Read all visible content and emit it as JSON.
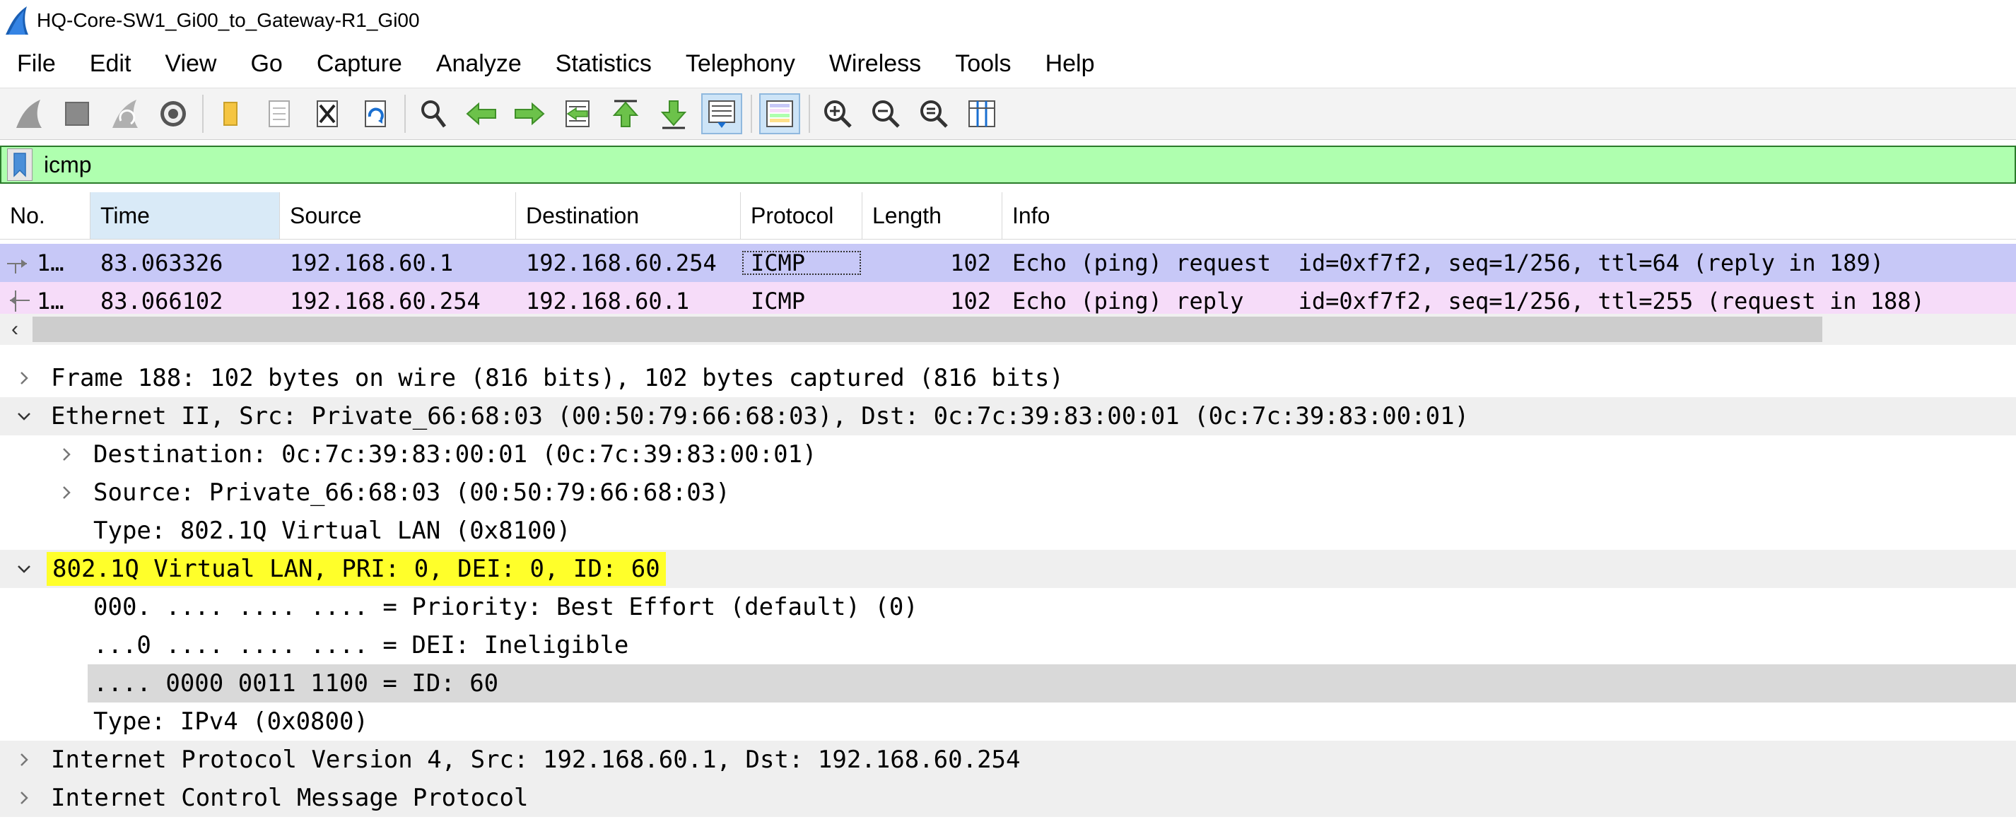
{
  "window": {
    "title": "HQ-Core-SW1_Gi00_to_Gateway-R1_Gi00",
    "app_icon": "wireshark-fin-icon"
  },
  "menu": [
    "File",
    "Edit",
    "View",
    "Go",
    "Capture",
    "Analyze",
    "Statistics",
    "Telephony",
    "Wireless",
    "Tools",
    "Help"
  ],
  "toolbar": [
    "start-capture-icon",
    "stop-capture-icon",
    "restart-capture-icon",
    "capture-options-icon",
    "open-file-icon",
    "save-file-icon",
    "close-file-icon",
    "reload-file-icon",
    "find-packet-icon",
    "go-back-icon",
    "go-forward-icon",
    "go-to-packet-icon",
    "go-first-icon",
    "go-last-icon",
    "autoscroll-icon",
    "colorize-icon",
    "zoom-in-icon",
    "zoom-out-icon",
    "zoom-normal-icon",
    "resize-columns-icon"
  ],
  "filter": {
    "value": "icmp"
  },
  "packet_list": {
    "columns": [
      "No.",
      "Time",
      "Source",
      "Destination",
      "Protocol",
      "Length",
      "Info"
    ],
    "rows": [
      {
        "no": "1…",
        "time": "83.063326",
        "source": "192.168.60.1",
        "destination": "192.168.60.254",
        "protocol": "ICMP",
        "length": "102",
        "info": "Echo (ping) request  id=0xf7f2, seq=1/256, ttl=64 (reply in 189)",
        "color": "#c7c8f7"
      },
      {
        "no": "1…",
        "time": "83.066102",
        "source": "192.168.60.254",
        "destination": "192.168.60.1",
        "protocol": "ICMP",
        "length": "102",
        "info": "Echo (ping) reply    id=0xf7f2, seq=1/256, ttl=255 (request in 188)",
        "color": "#f6dcf9"
      }
    ]
  },
  "details": [
    {
      "text": "Frame 188: 102 bytes on wire (816 bits), 102 bytes captured (816 bits)",
      "state": "collapsed"
    },
    {
      "text": "Ethernet II, Src: Private_66:68:03 (00:50:79:66:68:03), Dst: 0c:7c:39:83:00:01 (0c:7c:39:83:00:01)",
      "state": "expanded"
    },
    {
      "text": "Destination: 0c:7c:39:83:00:01 (0c:7c:39:83:00:01)",
      "state": "collapsed"
    },
    {
      "text": "Source: Private_66:68:03 (00:50:79:66:68:03)",
      "state": "collapsed"
    },
    {
      "text": "Type: 802.1Q Virtual LAN (0x8100)",
      "state": "leaf"
    },
    {
      "text": "802.1Q Virtual LAN, PRI: 0, DEI: 0, ID: 60",
      "state": "expanded"
    },
    {
      "text": "000. .... .... .... = Priority: Best Effort (default) (0)",
      "state": "leaf"
    },
    {
      "text": "...0 .... .... .... = DEI: Ineligible",
      "state": "leaf"
    },
    {
      "text": ".... 0000 0011 1100 = ID: 60",
      "state": "leaf"
    },
    {
      "text": "Type: IPv4 (0x0800)",
      "state": "leaf"
    },
    {
      "text": "Internet Protocol Version 4, Src: 192.168.60.1, Dst: 192.168.60.254",
      "state": "collapsed"
    },
    {
      "text": "Internet Control Message Protocol",
      "state": "collapsed"
    }
  ],
  "colors": {
    "filter_ok": "#afffaf",
    "request_row": "#c7c8f7",
    "reply_row": "#f6dcf9",
    "highlight": "#ffff2a",
    "selected_field": "#d9d9d9"
  }
}
